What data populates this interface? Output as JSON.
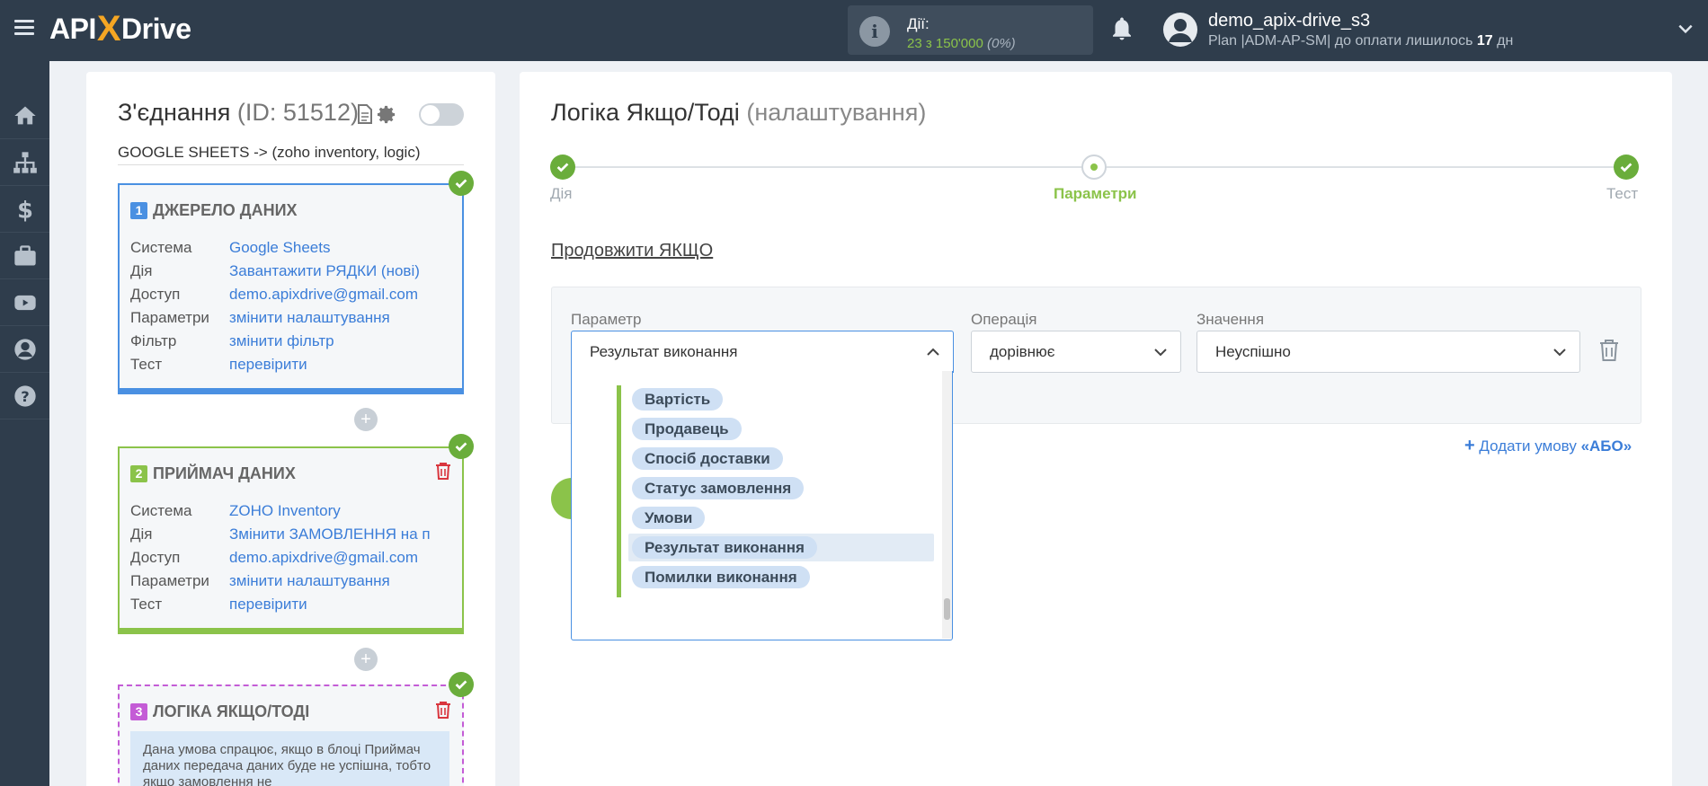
{
  "header": {
    "logo_left": "API",
    "logo_x": "X",
    "logo_right": "Drive",
    "actions_label": "Дії:",
    "actions_used": "23 з 150'000",
    "actions_pct": "(0%)",
    "user_name": "demo_apix-drive_s3",
    "plan_text": "Plan |ADM-AP-SM| до оплати лишилось",
    "plan_days": "17",
    "plan_unit": "дн"
  },
  "sidebar": {
    "items": [
      "home-icon",
      "sitemap-icon",
      "dollar-icon",
      "briefcase-icon",
      "youtube-icon",
      "user-icon",
      "help-icon"
    ]
  },
  "connection": {
    "title": "З'єднання",
    "id_text": "(ID: 51512)",
    "subtitle": "GOOGLE SHEETS -> (zoho inventory, logic)",
    "toggle_on": false
  },
  "source_block": {
    "num": "1",
    "title": "ДЖЕРЕЛО ДАНИХ",
    "rows": [
      {
        "k": "Система",
        "v": "Google Sheets"
      },
      {
        "k": "Дія",
        "v": "Завантажити РЯДКИ (нові)"
      },
      {
        "k": "Доступ",
        "v": "demo.apixdrive@gmail.com"
      },
      {
        "k": "Параметри",
        "v": "змінити налаштування"
      },
      {
        "k": "Фільтр",
        "v": "змінити фільтр"
      },
      {
        "k": "Тест",
        "v": "перевірити"
      }
    ]
  },
  "dest_block": {
    "num": "2",
    "title": "ПРИЙМАЧ ДАНИХ",
    "rows": [
      {
        "k": "Система",
        "v": "ZOHO Inventory"
      },
      {
        "k": "Дія",
        "v": "Змінити ЗАМОВЛЕННЯ на п"
      },
      {
        "k": "Доступ",
        "v": "demo.apixdrive@gmail.com"
      },
      {
        "k": "Параметри",
        "v": "змінити налаштування"
      },
      {
        "k": "Тест",
        "v": "перевірити"
      }
    ]
  },
  "logic_block": {
    "num": "3",
    "title": "ЛОГІКА ЯКЩО/ТОДІ",
    "note": "Дана умова спрацює, якщо в блоці Приймач даних передача даних буде не успішна, тобто якщо замовлення не"
  },
  "main": {
    "title": "Логіка Якщо/Тоді",
    "title_suffix": "(налаштування)",
    "steps": [
      "Дія",
      "Параметри",
      "Тест"
    ],
    "continue_label": "Продовжити ЯКЩО",
    "param_label": "Параметр",
    "param_value": "Результат виконання",
    "op_label": "Операція",
    "op_value": "дорівнює",
    "val_label": "Значення",
    "val_value": "Неуспішно",
    "add_or_prefix": "Додати умову",
    "add_or_word": "«АБО»"
  },
  "dropdown": {
    "options": [
      "Вартість",
      "Продавець",
      "Спосіб доставки",
      "Статус замовлення",
      "Умови",
      "Результат виконання",
      "Помилки виконання"
    ],
    "highlighted": "Результат виконання"
  },
  "colors": {
    "topbar": "#2f3d4c",
    "accent_blue": "#4a90e2",
    "accent_green": "#8bc34a",
    "accent_purple": "#c45cd6",
    "link": "#3b7dd8"
  }
}
